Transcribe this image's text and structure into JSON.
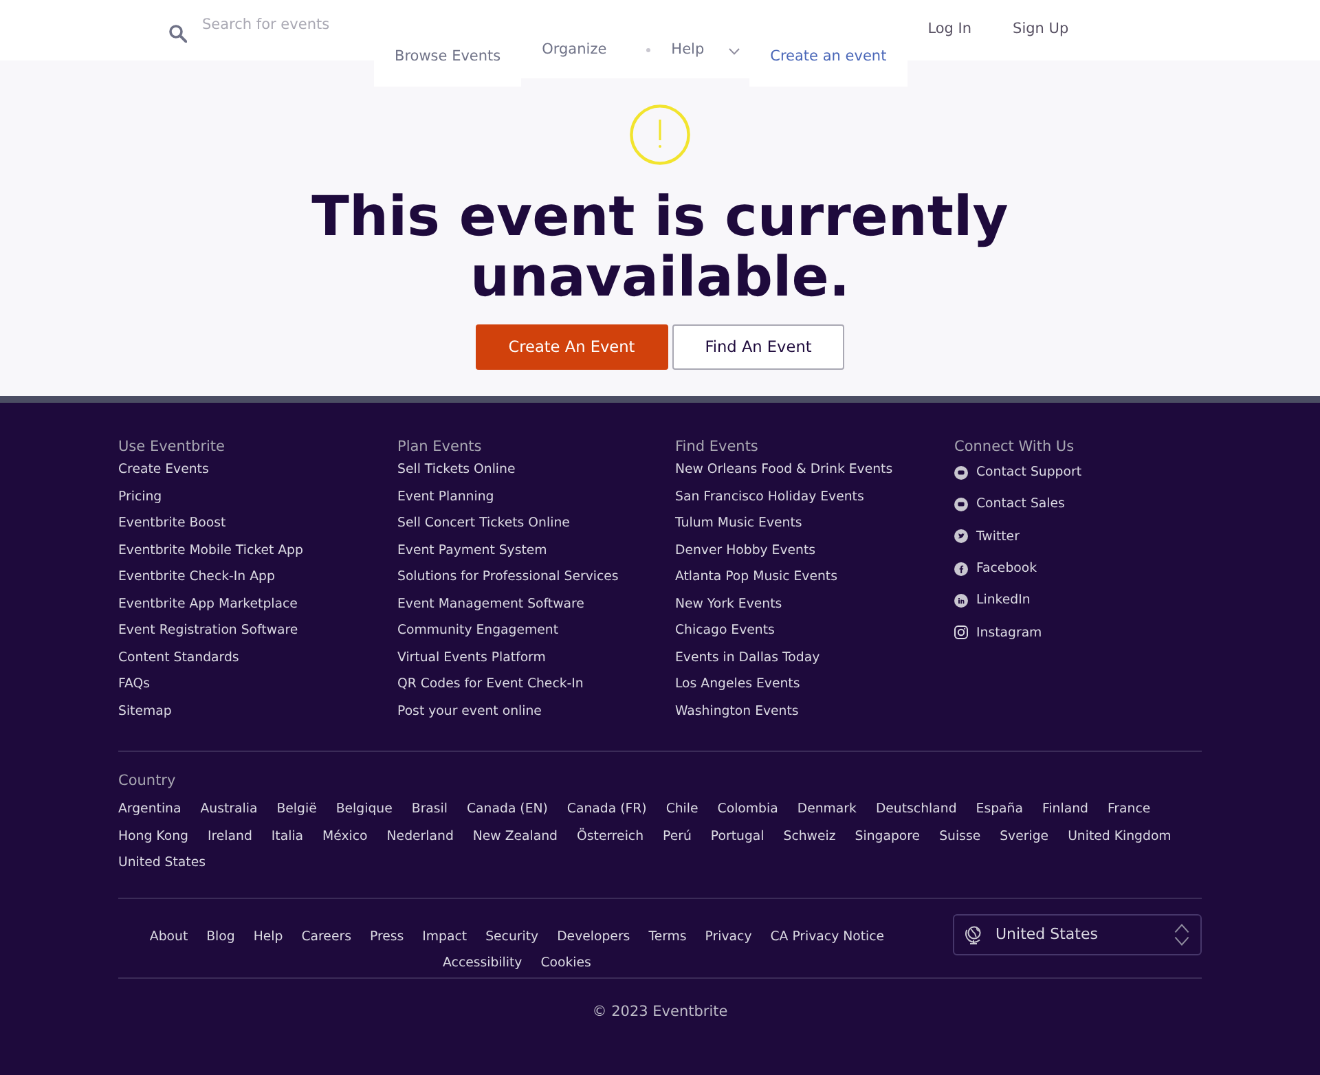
{
  "header": {
    "search": {
      "placeholder": "Search for events"
    },
    "nav": [
      {
        "kind": "link",
        "label": "Browse Events"
      },
      {
        "kind": "group",
        "items": [
          {
            "kind": "link",
            "label": "Organize"
          },
          {
            "kind": "dropdown",
            "label": "Help"
          }
        ]
      },
      {
        "kind": "cta",
        "label": "Create an event"
      }
    ],
    "auth": [
      {
        "label": "Log In"
      },
      {
        "label": "Sign Up"
      }
    ]
  },
  "notice": {
    "title": "This event is currently unavailable.",
    "buttons": [
      {
        "kind": "primary",
        "label": "Create An Event"
      },
      {
        "kind": "secondary",
        "label": "Find An Event"
      }
    ]
  },
  "footer": {
    "columns": [
      {
        "kind": "links",
        "heading": "Use Eventbrite",
        "items": [
          "Create Events",
          "Pricing",
          "Eventbrite Boost",
          "Eventbrite Mobile Ticket App",
          "Eventbrite Check-In App",
          "Eventbrite App Marketplace",
          "Event Registration Software",
          "Content Standards",
          "FAQs",
          "Sitemap"
        ]
      },
      {
        "kind": "links",
        "heading": "Plan Events",
        "items": [
          "Sell Tickets Online",
          "Event Planning",
          "Sell Concert Tickets Online",
          "Event Payment System",
          "Solutions for Professional Services",
          "Event Management Software",
          "Community Engagement",
          "Virtual Events Platform",
          "QR Codes for Event Check-In",
          "Post your event online"
        ]
      },
      {
        "kind": "links",
        "heading": "Find Events",
        "items": [
          "New Orleans Food & Drink Events",
          "San Francisco Holiday Events",
          "Tulum Music Events",
          "Denver Hobby Events",
          "Atlanta Pop Music Events",
          "New York Events",
          "Chicago Events",
          "Events in Dallas Today",
          "Los Angeles Events",
          "Washington Events"
        ]
      },
      {
        "kind": "social",
        "heading": "Connect With Us",
        "items": [
          "Contact Support",
          "Contact Sales",
          "Twitter",
          "Facebook",
          "LinkedIn",
          "Instagram"
        ]
      }
    ],
    "country": {
      "heading": "Country",
      "items": [
        "Argentina",
        "Australia",
        "België",
        "Belgique",
        "Brasil",
        "Canada (EN)",
        "Canada (FR)",
        "Chile",
        "Colombia",
        "Denmark",
        "Deutschland",
        "España",
        "Finland",
        "France",
        "Hong Kong",
        "Ireland",
        "Italia",
        "México",
        "Nederland",
        "New Zealand",
        "Österreich",
        "Perú",
        "Portugal",
        "Schweiz",
        "Singapore",
        "Suisse",
        "Sverige",
        "United Kingdom",
        "United States"
      ]
    },
    "bottom_links": [
      "About",
      "Blog",
      "Help",
      "Careers",
      "Press",
      "Impact",
      "Security",
      "Developers",
      "Terms",
      "Privacy",
      "CA Privacy Notice",
      "Accessibility",
      "Cookies"
    ],
    "locale_select": {
      "value": "United States"
    },
    "copyright": "© 2023 Eventbrite"
  }
}
